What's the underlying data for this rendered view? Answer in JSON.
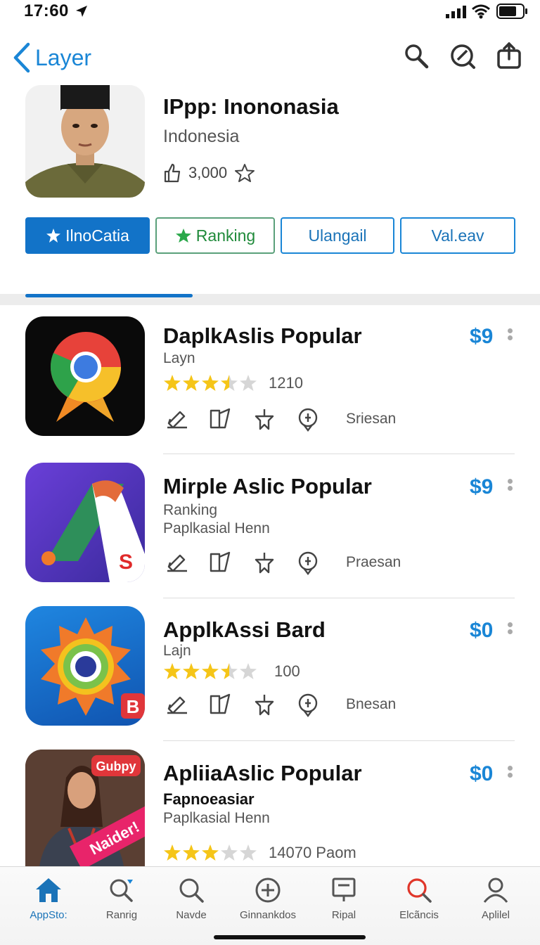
{
  "status_bar": {
    "time": "17:60"
  },
  "nav": {
    "back_label": "Layer"
  },
  "header": {
    "title": "IPpp: Inononasia",
    "subtitle": "Indonesia",
    "rating_count": "3,000"
  },
  "tabs": [
    {
      "label": "IlnoCatia"
    },
    {
      "label": "Ranking"
    },
    {
      "label": "Ulangail"
    },
    {
      "label": "Val.eav"
    }
  ],
  "apps": [
    {
      "title": "DaplkAslis Popular",
      "line2": "Layn",
      "line3": "",
      "rating": 3.5,
      "rating_count": "1210",
      "location_label": "Sriesan",
      "price": "$9"
    },
    {
      "title": "Mirple Aslic Popular",
      "line2": "Ranking",
      "line3": "Paplkasial Henn",
      "rating": null,
      "rating_count": "",
      "location_label": "Praesan",
      "price": "$9"
    },
    {
      "title": "ApplkAssi Bard",
      "line2": "Lajn",
      "line3": "",
      "rating": 3.5,
      "rating_count": "100",
      "location_label": "Bnesan",
      "price": "$0"
    },
    {
      "title": "ApliiaAslic Popular",
      "line2": "Fapnoeasiar",
      "line3": "Paplkasial Henn",
      "rating": 3,
      "rating_count": "14070  Paom",
      "location_label": "",
      "price": "$0",
      "badge": "Gubpy",
      "banner": "Naider!"
    }
  ],
  "tab_bar": [
    {
      "label": "AppSto:"
    },
    {
      "label": "Ranrig"
    },
    {
      "label": "Navde"
    },
    {
      "label": "Ginnankdos"
    },
    {
      "label": "Ripal"
    },
    {
      "label": "Elcãncis"
    },
    {
      "label": "Aplilel"
    }
  ],
  "colors": {
    "accent": "#1a86d6",
    "active_tab": "#1273c8",
    "star": "#f5c518",
    "green": "#2aa84a"
  }
}
